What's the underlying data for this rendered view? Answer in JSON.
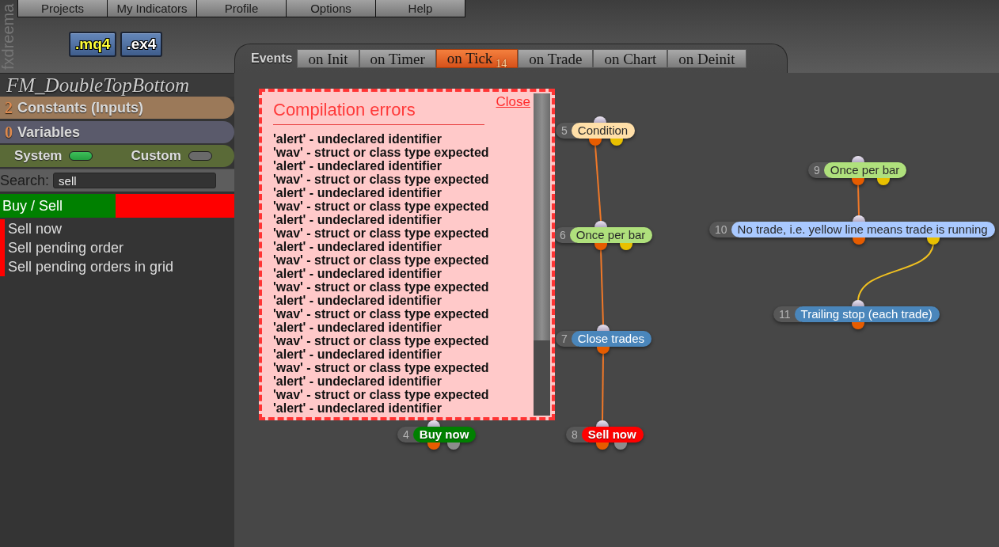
{
  "logo": "fxdreema",
  "menu": [
    "Projects",
    "My Indicators",
    "Profile",
    "Options",
    "Help"
  ],
  "file_buttons": [
    {
      "label": ".mq4",
      "highlighted": true
    },
    {
      "label": ".ex4",
      "highlighted": false
    }
  ],
  "events": {
    "label": "Events",
    "tabs": [
      {
        "label": "on Init",
        "selected": false
      },
      {
        "label": "on Timer",
        "selected": false
      },
      {
        "label": "on Tick",
        "count": "14",
        "selected": true
      },
      {
        "label": "on Trade",
        "selected": false
      },
      {
        "label": "on Chart",
        "selected": false
      },
      {
        "label": "on Deinit",
        "selected": false
      }
    ]
  },
  "sidebar": {
    "project_title": "FM_DoubleTopBottom",
    "sections": [
      {
        "count": "2",
        "label": "Constants (Inputs)",
        "color": "#9b7959"
      },
      {
        "count": "0",
        "label": "Variables",
        "color": "#5a5a6b"
      }
    ],
    "filters": [
      {
        "label": "System",
        "on": true
      },
      {
        "label": "Custom",
        "on": false
      }
    ],
    "search": {
      "label": "Search:",
      "value": "sell"
    },
    "category": {
      "label": "Buy / Sell",
      "items": [
        "Sell now",
        "Sell pending order",
        "Sell pending orders in grid"
      ]
    }
  },
  "canvas": {
    "error_panel": {
      "title": "Compilation errors",
      "close": "Close",
      "lines": [
        "'alert' - undeclared identifier",
        "'wav' - struct or class type expected",
        "'alert' - undeclared identifier",
        "'wav' - struct or class type expected",
        "'alert' - undeclared identifier",
        "'wav' - struct or class type expected",
        "'alert' - undeclared identifier",
        "'wav' - struct or class type expected",
        "'alert' - undeclared identifier",
        "'wav' - struct or class type expected",
        "'alert' - undeclared identifier",
        "'wav' - struct or class type expected",
        "'alert' - undeclared identifier",
        "'wav' - struct or class type expected",
        "'alert' - undeclared identifier",
        "'wav' - struct or class type expected",
        "'alert' - undeclared identifier",
        "'wav' - struct or class type expected",
        "'alert' - undeclared identifier",
        "'wav' - struct or class type expected",
        "'alert' - undeclared identifier"
      ]
    },
    "nodes": [
      {
        "number": "4",
        "label": "Buy now",
        "kind": "order",
        "color": "#008000",
        "outputs": [
          {
            "color": "#e65c00"
          },
          {
            "color": "#8c8c8c"
          }
        ]
      },
      {
        "number": "5",
        "label": "Condition",
        "kind": "block",
        "color": "#ffdfa8",
        "outputs": [
          {
            "color": "#e65c00"
          },
          {
            "color": "#e8c000"
          }
        ]
      },
      {
        "number": "6",
        "label": "Once per bar",
        "kind": "block",
        "color": "#afe07c",
        "outputs": [
          {
            "color": "#e65c00"
          },
          {
            "color": "#e8c000"
          }
        ]
      },
      {
        "number": "7",
        "label": "Close trades",
        "kind": "block",
        "color": "#4a86bb",
        "outputs": [
          {
            "color": "#e65c00"
          }
        ]
      },
      {
        "number": "8",
        "label": "Sell now",
        "kind": "order",
        "color": "#ff0000",
        "outputs": [
          {
            "color": "#e65c00"
          },
          {
            "color": "#8c8c8c"
          }
        ]
      },
      {
        "number": "9",
        "label": "Once per bar",
        "kind": "block",
        "color": "#afe07c",
        "outputs": [
          {
            "color": "#e65c00"
          },
          {
            "color": "#e8c000"
          }
        ]
      },
      {
        "number": "10",
        "label": "No trade, i.e. yellow line means trade is running",
        "kind": "block",
        "color": "#a9c9ff",
        "outputs": [
          {
            "color": "#e65c00"
          },
          {
            "color": "#e8c000"
          }
        ]
      },
      {
        "number": "11",
        "label": "Trailing stop (each trade)",
        "kind": "block",
        "color": "#4a86bb",
        "outputs": [
          {
            "color": "#e65c00"
          }
        ]
      }
    ],
    "links": [
      {
        "color": "#f07828"
      },
      {
        "color": "#f07828"
      },
      {
        "color": "#f07828"
      },
      {
        "color": "#f07828"
      },
      {
        "color": "#f0c020"
      }
    ]
  }
}
